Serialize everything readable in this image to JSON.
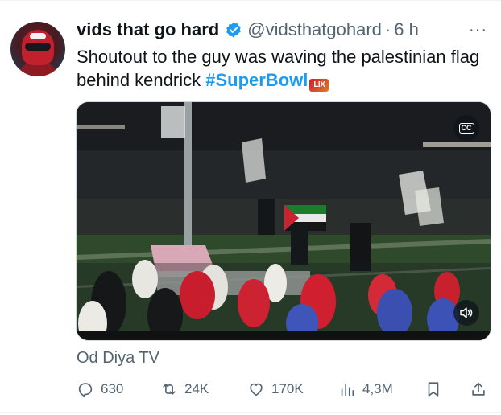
{
  "tweet": {
    "author_name": "vids that go hard",
    "handle": "@vidsthatgohard",
    "separator": "·",
    "time": "6 h",
    "more_label": "···",
    "text_part1": "Shoutout to the guy was waving the palestinian flag behind kendrick ",
    "hashtag": "#SuperBowl",
    "hashtag_emoji_text": "LIX"
  },
  "media": {
    "cc_label": "CC"
  },
  "source": "Od Diya TV",
  "actions": {
    "replies": "630",
    "reposts": "24K",
    "likes": "170K",
    "views": "4,3M"
  },
  "icons": {
    "verified": "verified-badge-icon",
    "reply": "reply-icon",
    "repost": "repost-icon",
    "like": "heart-icon",
    "views": "views-icon",
    "bookmark": "bookmark-icon",
    "share": "share-icon",
    "volume": "volume-icon"
  },
  "colors": {
    "accent": "#1d9bf0",
    "text": "#0f1419",
    "muted": "#536471"
  }
}
